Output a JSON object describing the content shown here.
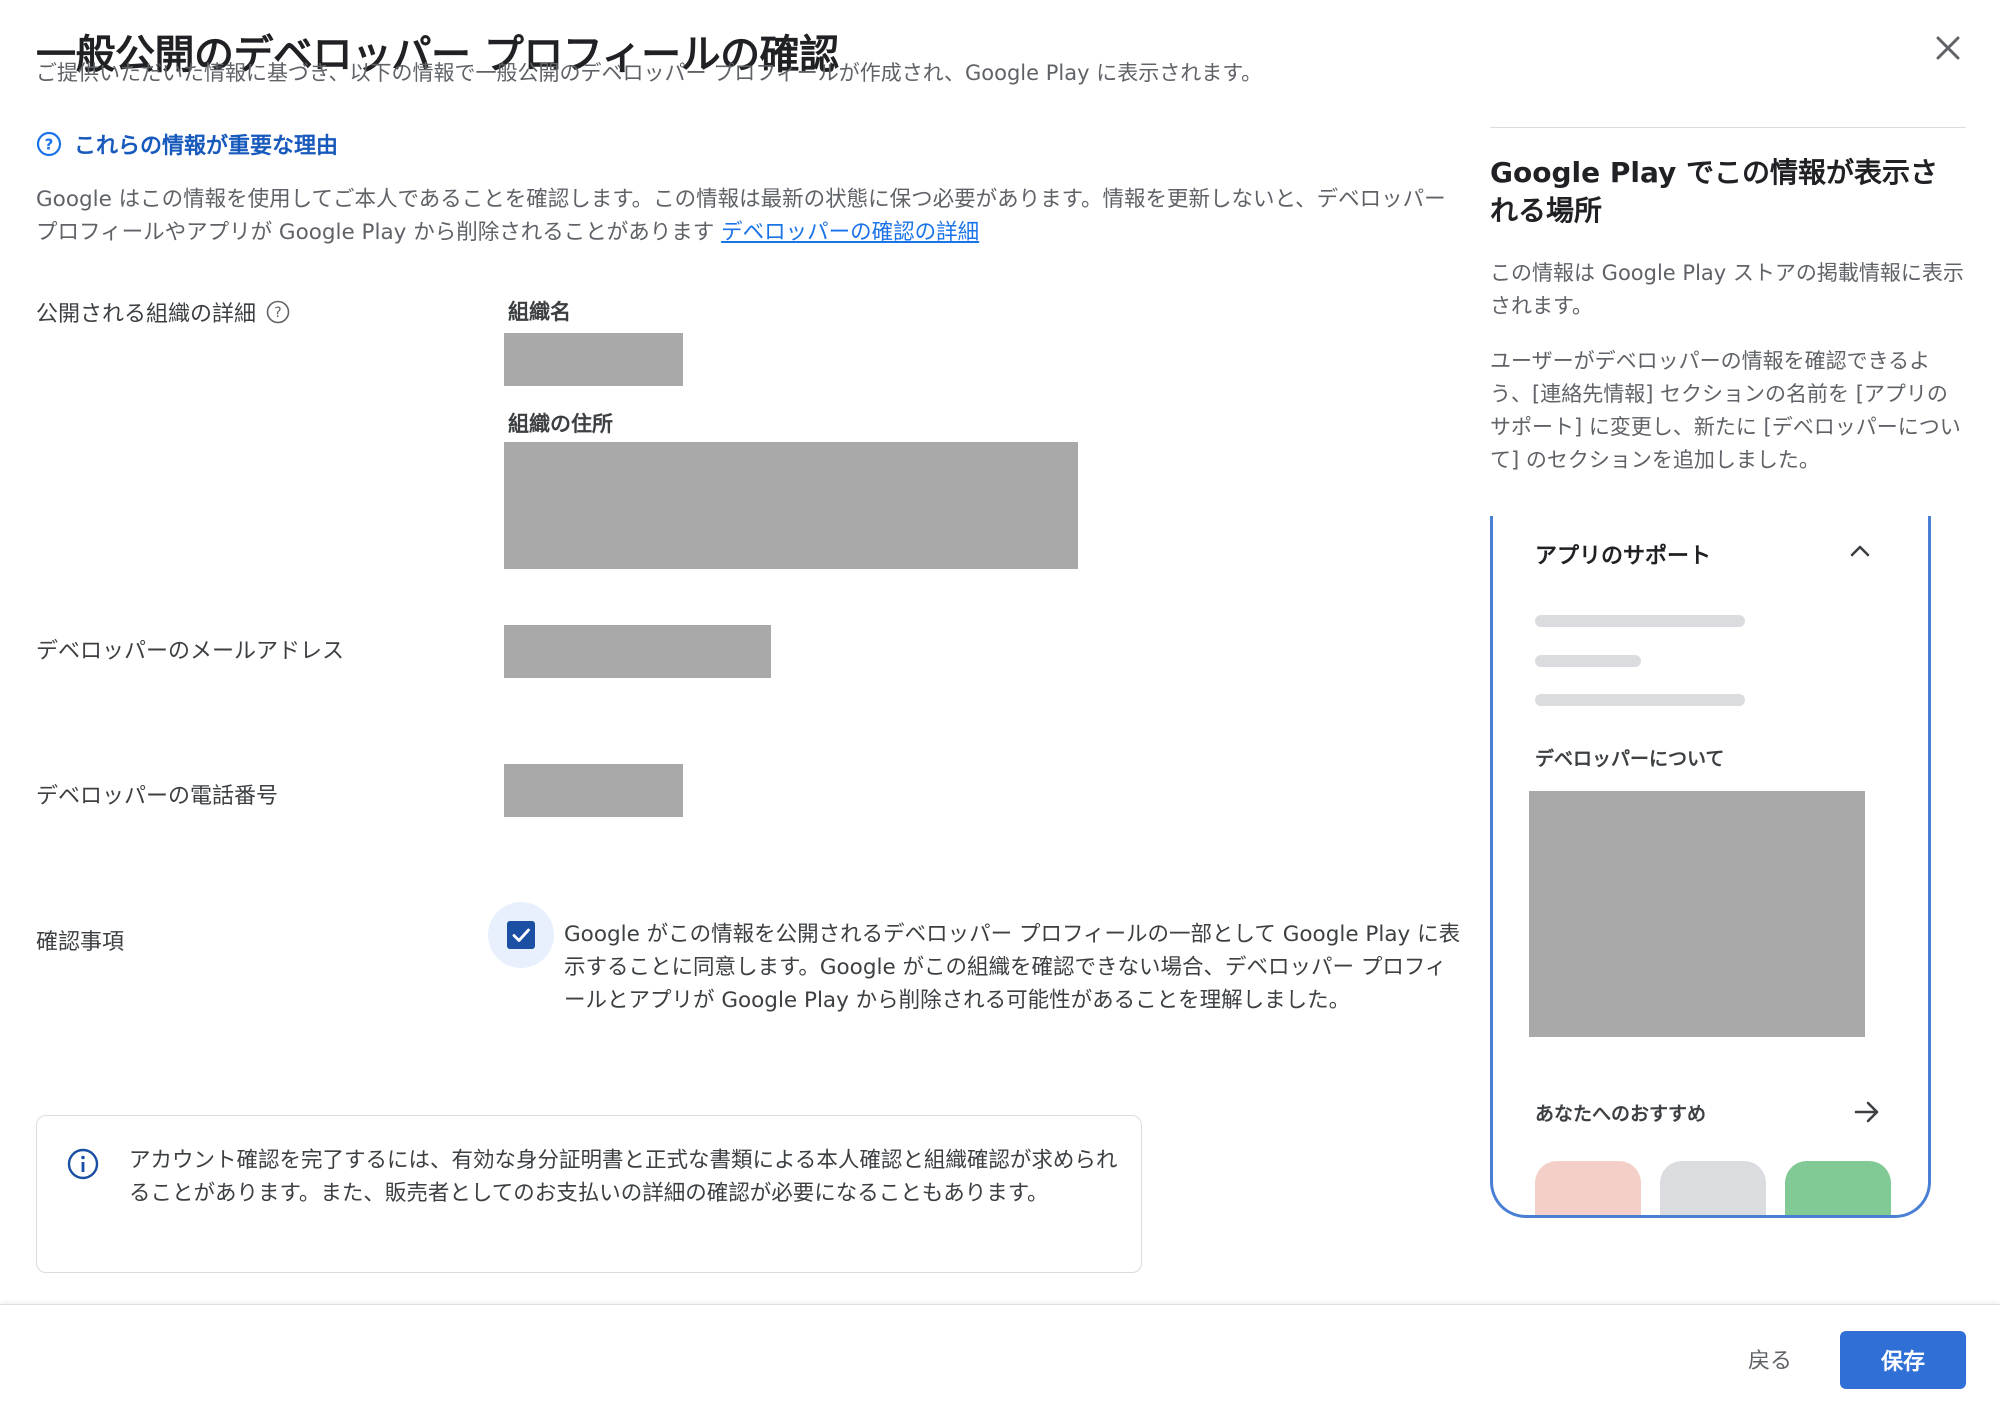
{
  "dialog": {
    "title": "一般公開のデベロッパー プロフィールの確認",
    "subtitle": "ご提供いただいた情報に基づき、以下の情報で一般公開のデベロッパー プロフィールが作成され、Google Play に表示されます。",
    "close_icon": "close-icon"
  },
  "why": {
    "icon": "help-circle-icon",
    "label": "これらの情報が重要な理由",
    "description": "Google はこの情報を使用してご本人であることを確認します。この情報は最新の状態に保つ必要があります。情報を更新しないと、デベロッパー プロフィールやアプリが Google Play から削除されることがあります",
    "link": "デベロッパーの確認の詳細"
  },
  "fields": {
    "org_details_label": "公開される組織の詳細",
    "org_name_label": "組織名",
    "org_address_label": "組織の住所",
    "email_label": "デベロッパーのメールアドレス",
    "phone_label": "デベロッパーの電話番号",
    "confirm_label": "確認事項"
  },
  "consent": {
    "checked": true,
    "text": "Google がこの情報を公開されるデベロッパー プロフィールの一部として Google Play に表示することに同意します。Google がこの組織を確認できない場合、デベロッパー プロフィールとアプリが Google Play から削除される可能性があることを理解しました。"
  },
  "info": {
    "icon": "info-icon",
    "text": "アカウント確認を完了するには、有効な身分証明書と正式な書類による本人確認と組織確認が求められることがあります。また、販売者としてのお支払いの詳細の確認が必要になることもあります。"
  },
  "side": {
    "title": "Google Play でこの情報が表示される場所",
    "p1": "この情報は Google Play ストアの掲載情報に表示されます。",
    "p2": "ユーザーがデベロッパーの情報を確認できるよう、[連絡先情報] セクションの名前を [アプリのサポート] に変更し、新たに [デベロッパーについて] のセクションを追加しました。",
    "preview": {
      "support_title": "アプリのサポート",
      "about_title": "デベロッパーについて",
      "recommend_title": "あなたへのおすすめ",
      "tile_colors": [
        "#f4cfc9",
        "#dadce0",
        "#81c995"
      ]
    }
  },
  "footer": {
    "back_label": "戻る",
    "save_label": "保存"
  },
  "colors": {
    "accent": "#1a73e8",
    "redacted": "#a9a9a9"
  }
}
